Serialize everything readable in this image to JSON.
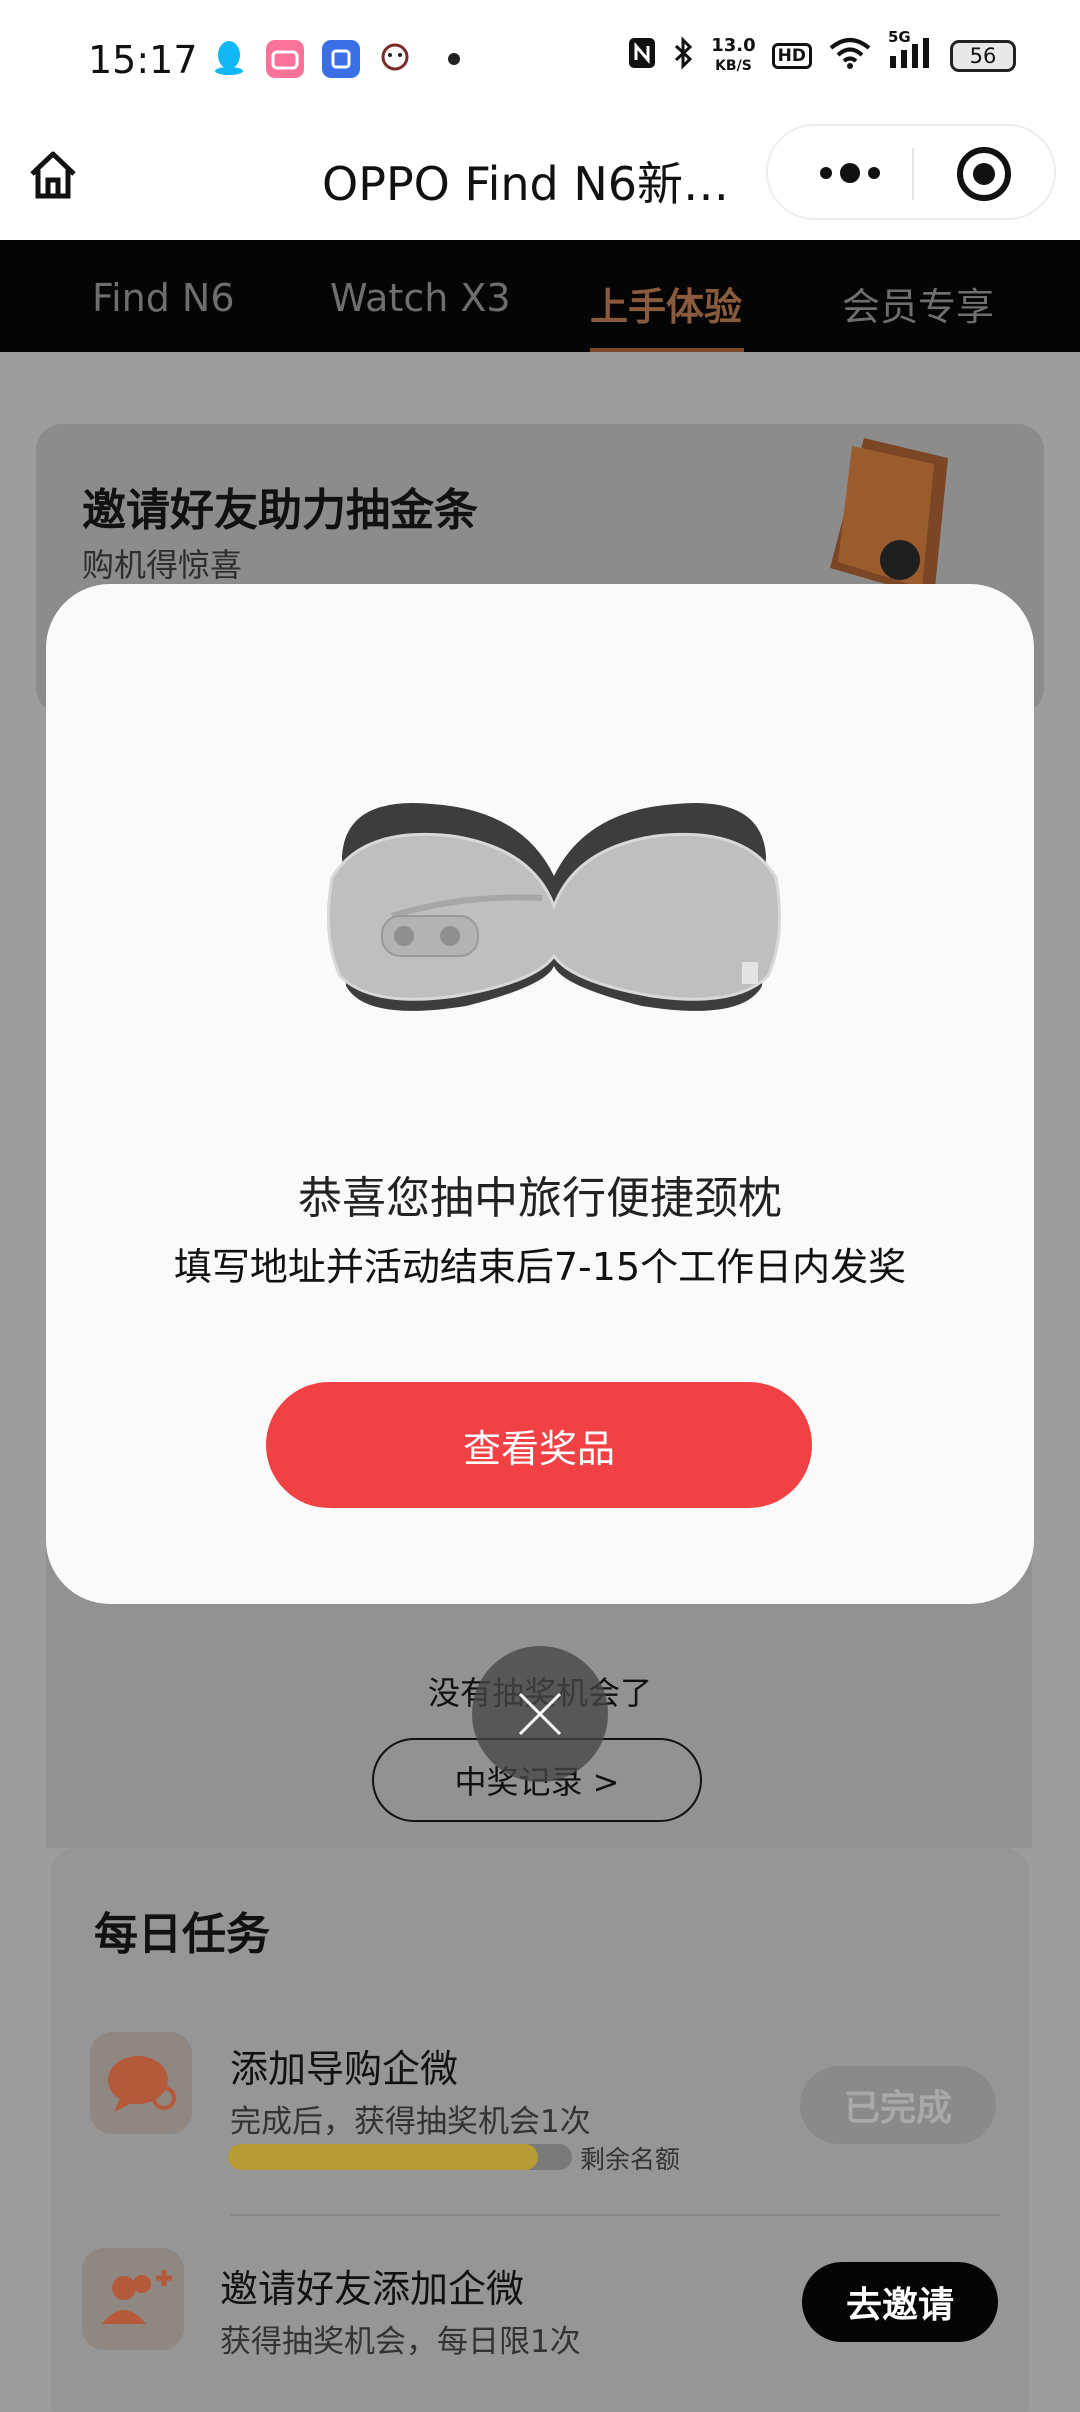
{
  "status_bar": {
    "time": "15:17",
    "network_speed_value": "13.0",
    "network_speed_unit": "KB/S",
    "hd_label": "HD",
    "signal_label": "5G",
    "battery": "56",
    "app_icons": [
      "qq-icon",
      "bilibili-icon",
      "app-icon",
      "game-icon"
    ]
  },
  "title_bar": {
    "title": "OPPO Find N6新…"
  },
  "nav_tabs": [
    {
      "label": "Find N6",
      "active": false
    },
    {
      "label": "Watch X3",
      "active": false
    },
    {
      "label": "上手体验",
      "active": true
    },
    {
      "label": "会员专享",
      "active": false
    }
  ],
  "banner": {
    "title": "邀请好友助力抽金条",
    "subtitle": "购机得惊喜"
  },
  "modal": {
    "title": "恭喜您抽中旅行便捷颈枕",
    "subtitle": "填写地址并活动结束后7-15个工作日内发奖",
    "button_label": "查看奖品"
  },
  "lottery": {
    "no_chance_text": "没有抽奖机会了",
    "record_button": "中奖记录 >"
  },
  "tasks": {
    "title": "每日任务",
    "items": [
      {
        "name": "添加导购企微",
        "desc": "完成后，获得抽奖机会1次",
        "progress": 0.9,
        "progress_label": "剩余名额",
        "button": "已完成"
      },
      {
        "name": "邀请好友添加企微",
        "desc": "获得抽奖机会，每日限1次",
        "button": "去邀请"
      }
    ]
  },
  "colors": {
    "accent_red": "#f24145",
    "tab_active": "#8a5a3d",
    "overlay_gray": "#9d9d9d"
  }
}
